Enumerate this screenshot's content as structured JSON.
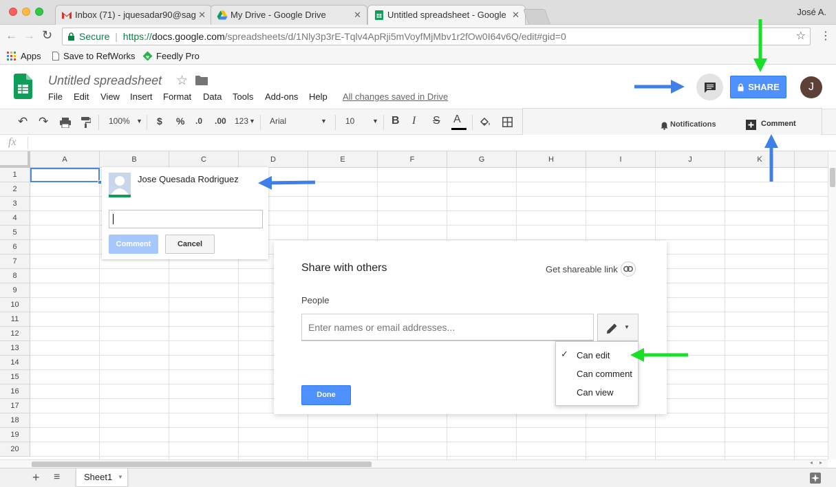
{
  "browser": {
    "tabs": [
      {
        "title": "Inbox (71) - jquesadar90@sag",
        "icon": "gmail-icon"
      },
      {
        "title": "My Drive - Google Drive",
        "icon": "drive-icon"
      },
      {
        "title": "Untitled spreadsheet - Google",
        "icon": "sheets-icon"
      }
    ],
    "profile_name": "José A.",
    "url_secure_label": "Secure",
    "url_scheme": "https://",
    "url_host": "docs.google.com",
    "url_path": "/spreadsheets/d/1Nly3p3rE-Tqlv4ApRji5mVoyfMjMbv1r2fOw0I64v6Q/edit#gid=0",
    "bookmarks": [
      "Apps",
      "Save to RefWorks",
      "Feedly Pro"
    ]
  },
  "doc": {
    "title": "Untitled spreadsheet",
    "menu": [
      "File",
      "Edit",
      "View",
      "Insert",
      "Format",
      "Data",
      "Tools",
      "Add-ons",
      "Help"
    ],
    "save_status": "All changes saved in Drive",
    "share_label": "SHARE",
    "avatar_initial": "J"
  },
  "toolbar": {
    "zoom": "100%",
    "currency": "$",
    "percent": "%",
    "dec_less": ".0",
    "dec_more": ".00",
    "more_formats": "123",
    "font": "Arial",
    "font_size": "10",
    "bold": "B",
    "italic": "I",
    "strike": "S",
    "text_color": "A"
  },
  "notifications_panel": {
    "notifications_label": "Notifications",
    "comment_label": "Comment"
  },
  "formula_bar": {
    "fx": "fx"
  },
  "grid": {
    "columns": [
      "A",
      "B",
      "C",
      "D",
      "E",
      "F",
      "G",
      "H",
      "I",
      "J",
      "K"
    ],
    "rows": [
      "1",
      "2",
      "3",
      "4",
      "5",
      "6",
      "7",
      "8",
      "9",
      "10",
      "11",
      "12",
      "13",
      "14",
      "15",
      "16",
      "17",
      "18",
      "19",
      "20"
    ]
  },
  "comment_popup": {
    "author": "Jose Quesada Rodriguez",
    "comment_button": "Comment",
    "cancel_button": "Cancel"
  },
  "share_dialog": {
    "title": "Share with others",
    "get_link": "Get shareable link",
    "people_label": "People",
    "input_placeholder": "Enter names or email addresses...",
    "done_button": "Done",
    "permissions": [
      "Can edit",
      "Can comment",
      "Can view"
    ],
    "selected_permission_index": 0
  },
  "sheet_tabs": {
    "active": "Sheet1"
  },
  "colors": {
    "sheets_green": "#0f9d58",
    "share_blue": "#4d90fe",
    "annotation_blue": "#3f7fe8",
    "annotation_green": "#18e028"
  }
}
